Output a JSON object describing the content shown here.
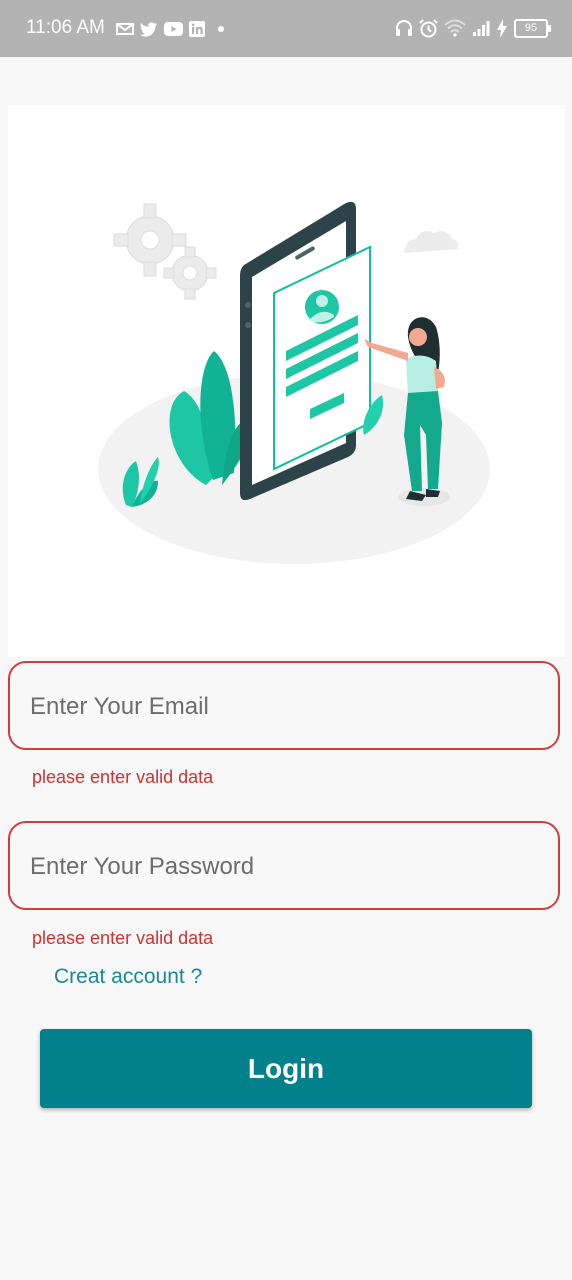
{
  "status_bar": {
    "time": "11:06 AM",
    "battery": "95",
    "left_icons": [
      "mail-icon",
      "twitter-icon",
      "youtube-icon",
      "linkedin-icon",
      "dot-icon"
    ],
    "right_icons": [
      "headphones-icon",
      "alarm-icon",
      "wifi-icon",
      "signal-icon",
      "charging-icon"
    ]
  },
  "hero": {
    "description_icon": "login-illustration"
  },
  "form": {
    "email_placeholder": "Enter Your Email",
    "email_error": "please enter valid data",
    "password_placeholder": "Enter Your Password",
    "password_error": "please enter valid data",
    "create_account_label": "Creat account ?",
    "login_label": "Login"
  },
  "colors": {
    "accent": "#00818b",
    "link": "#1a8a96",
    "error": "#d23030",
    "status_bar": "#b3b3b3"
  }
}
